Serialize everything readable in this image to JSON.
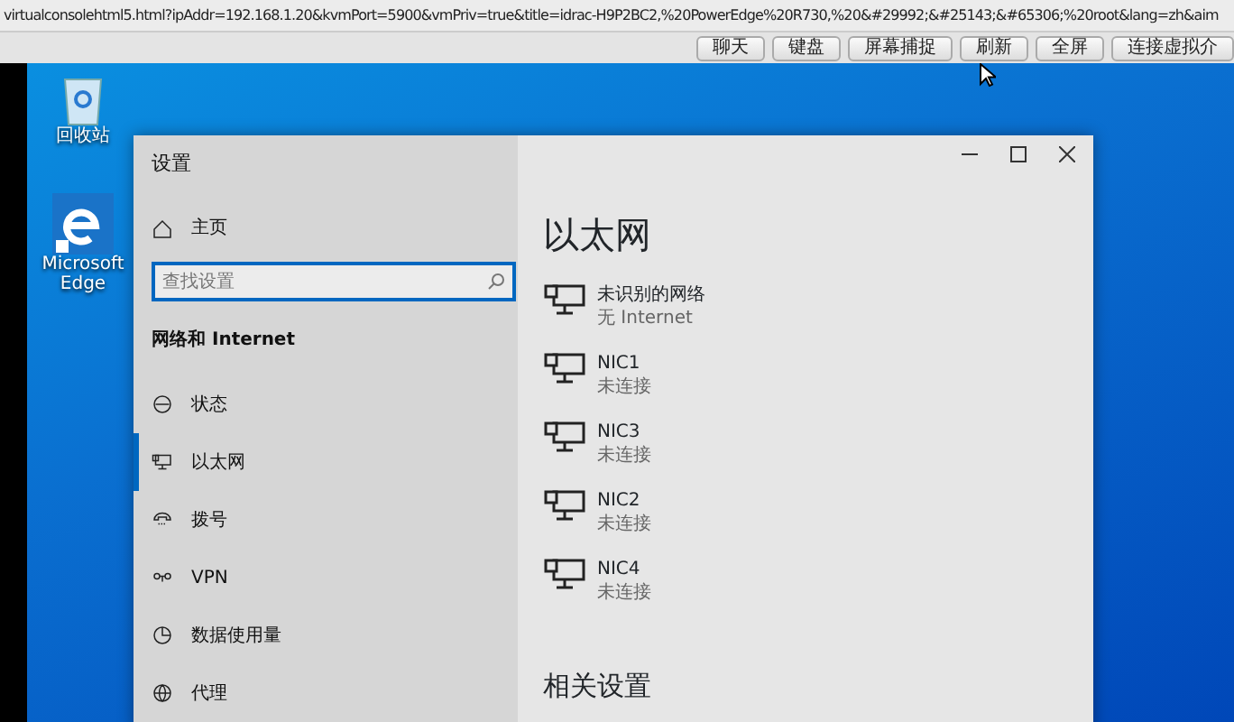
{
  "address_bar": {
    "url": "virtualconsolehtml5.html?ipAddr=192.168.1.20&kvmPort=5900&vmPriv=true&title=idrac-H9P2BC2,%20PowerEdge%20R730,%20&#29992;&#25143;&#65306;%20root&lang=zh&aim"
  },
  "toolbar": {
    "buttons": [
      "聊天",
      "键盘",
      "屏幕捕捉",
      "刷新",
      "全屏",
      "连接虚拟介"
    ]
  },
  "desktop_icons": [
    {
      "kind": "recycle",
      "label": "回收站"
    },
    {
      "kind": "edge",
      "label": "Microsoft Edge"
    }
  ],
  "window": {
    "title": "设置",
    "home": "主页",
    "search": {
      "placeholder": "查找设置"
    },
    "section": "网络和 Internet",
    "nav": [
      {
        "kind": "status",
        "label": "状态",
        "selected": false
      },
      {
        "kind": "ethernet",
        "label": "以太网",
        "selected": true
      },
      {
        "kind": "dialup",
        "label": "拨号",
        "selected": false
      },
      {
        "kind": "vpn",
        "label": "VPN",
        "selected": false
      },
      {
        "kind": "data",
        "label": "数据使用量",
        "selected": false
      },
      {
        "kind": "proxy",
        "label": "代理",
        "selected": false
      }
    ],
    "heading": "以太网",
    "adapters": [
      {
        "name": "未识别的网络",
        "status": "无 Internet"
      },
      {
        "name": "NIC1",
        "status": "未连接"
      },
      {
        "name": "NIC3",
        "status": "未连接"
      },
      {
        "name": "NIC2",
        "status": "未连接"
      },
      {
        "name": "NIC4",
        "status": "未连接"
      }
    ],
    "related_heading": "相关设置"
  }
}
